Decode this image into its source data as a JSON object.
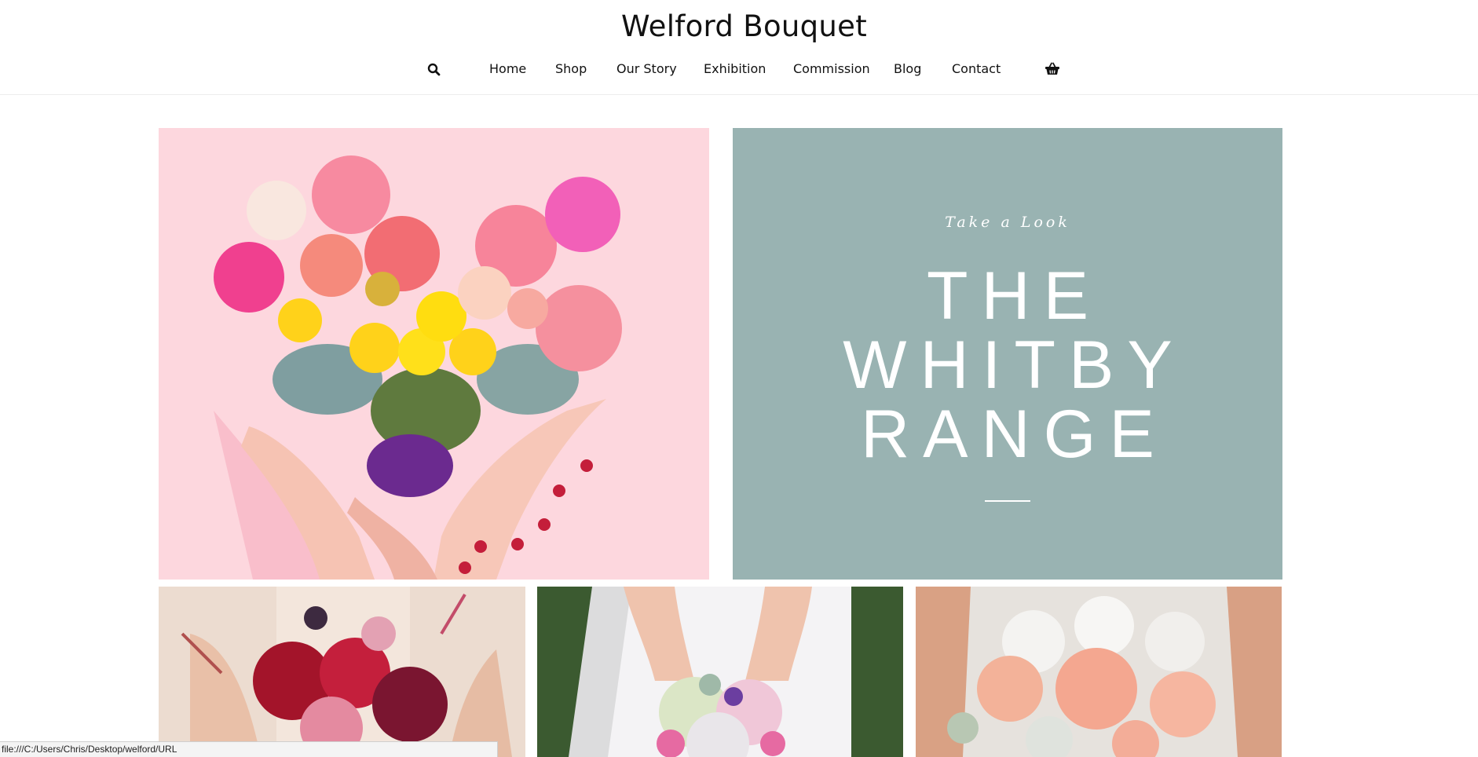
{
  "header": {
    "site_title": "Welford Bouquet"
  },
  "nav": {
    "search_icon": "search-icon",
    "cart_icon": "basket-icon",
    "items": [
      {
        "label": "Home"
      },
      {
        "label": "Shop"
      },
      {
        "label": "Our Story"
      },
      {
        "label": "Exhibition"
      },
      {
        "label": "Commission"
      },
      {
        "label": "Blog"
      },
      {
        "label": "Contact"
      }
    ]
  },
  "hero": {
    "promo": {
      "kicker": "Take a Look",
      "title_lines": [
        "THE",
        "WHITBY",
        "RANGE"
      ],
      "background": "#99b3b2"
    },
    "heart_background": "#fdd7de"
  },
  "status_bar": {
    "url": "file:///C:/Users/Chris/Desktop/welford/URL"
  },
  "colors": {
    "accent_text": "#111111",
    "promo_text": "#ffffff"
  }
}
